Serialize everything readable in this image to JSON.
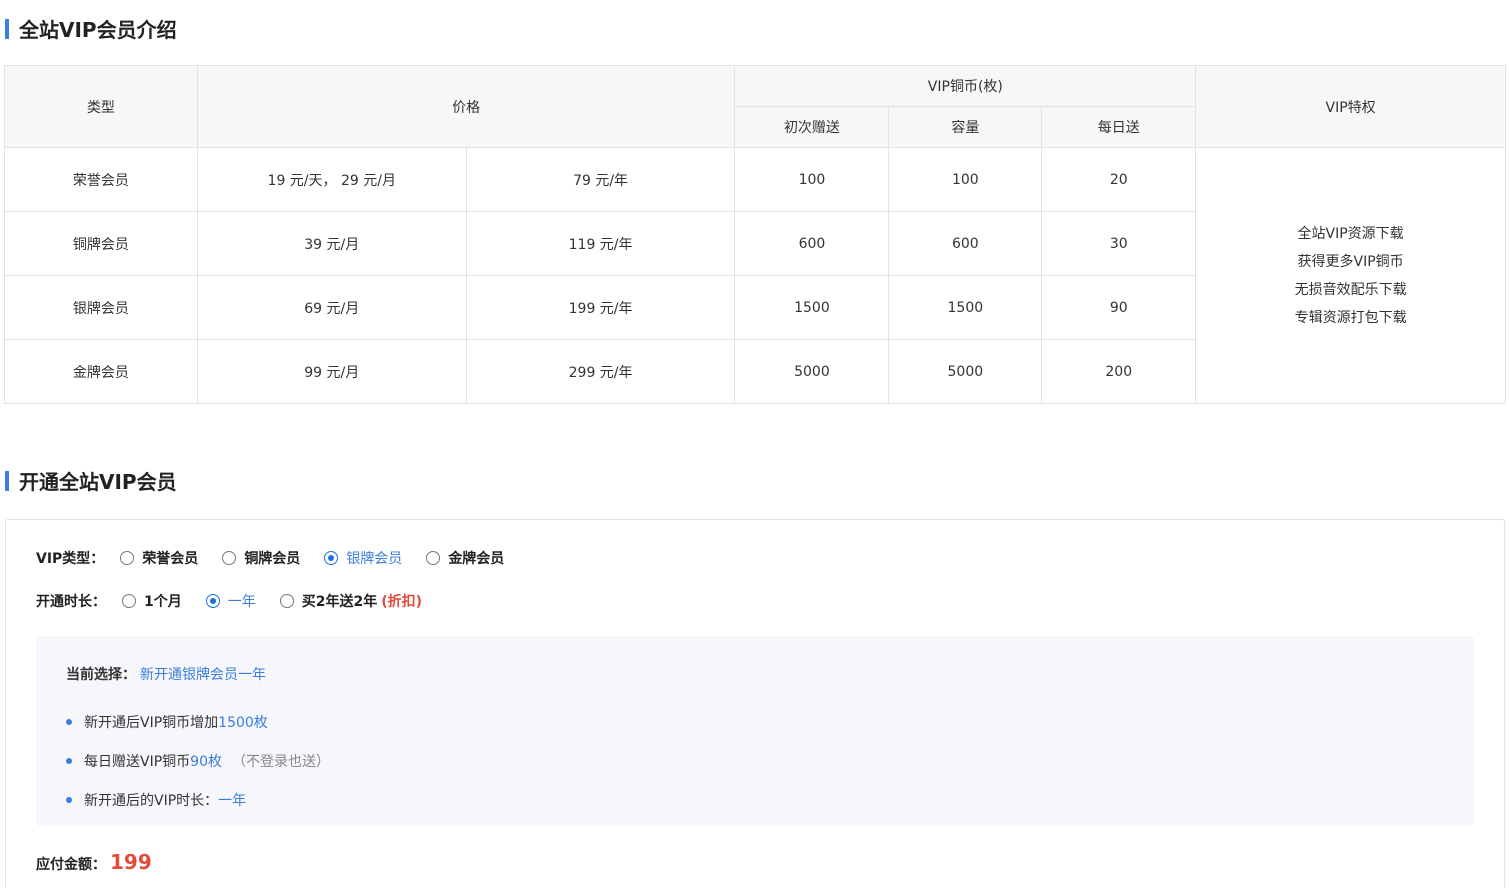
{
  "section1": {
    "title": "全站VIP会员介绍"
  },
  "table": {
    "headers": {
      "type": "类型",
      "price": "价格",
      "coins": "VIP铜币(枚)",
      "first_gift": "初次赠送",
      "capacity": "容量",
      "daily": "每日送",
      "privileges": "VIP特权"
    },
    "rows": [
      {
        "type": "荣誉会员",
        "price_a": "19 元/天， 29 元/月",
        "price_b": "79 元/年",
        "first": "100",
        "capacity": "100",
        "daily": "20"
      },
      {
        "type": "铜牌会员",
        "price_a": "39 元/月",
        "price_b": "119 元/年",
        "first": "600",
        "capacity": "600",
        "daily": "30"
      },
      {
        "type": "银牌会员",
        "price_a": "69 元/月",
        "price_b": "199 元/年",
        "first": "1500",
        "capacity": "1500",
        "daily": "90"
      },
      {
        "type": "金牌会员",
        "price_a": "99 元/月",
        "price_b": "299 元/年",
        "first": "5000",
        "capacity": "5000",
        "daily": "200"
      }
    ],
    "privileges": [
      "全站VIP资源下载",
      "获得更多VIP铜币",
      "无损音效配乐下载",
      "专辑资源打包下载"
    ]
  },
  "section2": {
    "title": "开通全站VIP会员"
  },
  "form": {
    "type_label": "VIP类型：",
    "type_options": [
      "荣誉会员",
      "铜牌会员",
      "银牌会员",
      "金牌会员"
    ],
    "type_selected": "银牌会员",
    "duration_label": "开通时长：",
    "duration_options": [
      "1个月",
      "一年",
      "买2年送2年"
    ],
    "duration_selected": "一年",
    "discount_tag": "(折扣)"
  },
  "summary": {
    "current_label": "当前选择：",
    "current_value": "新开通银牌会员一年",
    "item1_text": "新开通后VIP铜币增加",
    "item1_value": "1500枚",
    "item2_text": "每日赠送VIP铜币",
    "item2_value": "90枚",
    "item2_note": "（不登录也送）",
    "item3_text": "新开通后的VIP时长：",
    "item3_value": "一年"
  },
  "payment": {
    "label": "应付金额：",
    "amount": "199"
  },
  "colors": {
    "accent": "#3b7ddd",
    "price": "#e14b3b",
    "border": "#e2e2e2",
    "header_bg": "#f7f7f8",
    "summary_bg": "#f6f7fb"
  }
}
